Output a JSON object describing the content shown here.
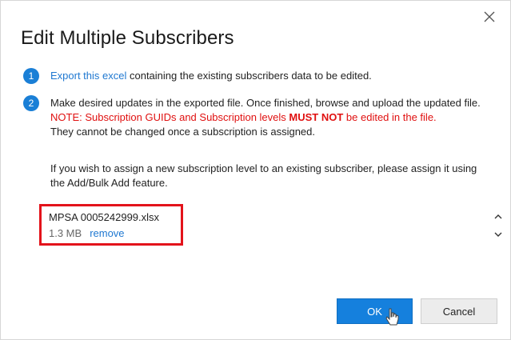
{
  "dialog": {
    "title": "Edit Multiple Subscribers",
    "close_icon": "close-icon"
  },
  "steps": [
    {
      "number": "1",
      "link_text": "Export this excel",
      "text_after_link": " containing the existing subscribers data to be edited."
    },
    {
      "number": "2",
      "text": "Make desired updates in the exported file. Once finished, browse and upload the updated file.",
      "note_prefix": "NOTE: Subscription GUIDs and Subscription levels ",
      "note_emphasis": "MUST NOT",
      "note_suffix": " be edited in the file.",
      "after_note": "They cannot be changed once a subscription is assigned."
    }
  ],
  "info": "If you wish to assign a new subscription level to an existing subscriber, please assign it using the Add/Bulk Add feature.",
  "file": {
    "name": "MPSA 0005242999.xlsx",
    "size": "1.3 MB",
    "remove_label": "remove"
  },
  "buttons": {
    "ok_label": "OK",
    "cancel_label": "Cancel"
  },
  "colors": {
    "accent": "#1580dd",
    "step_badge": "#1a7fd6",
    "link": "#1f78d1",
    "note": "#e01010",
    "highlight_box": "#e3131b"
  }
}
